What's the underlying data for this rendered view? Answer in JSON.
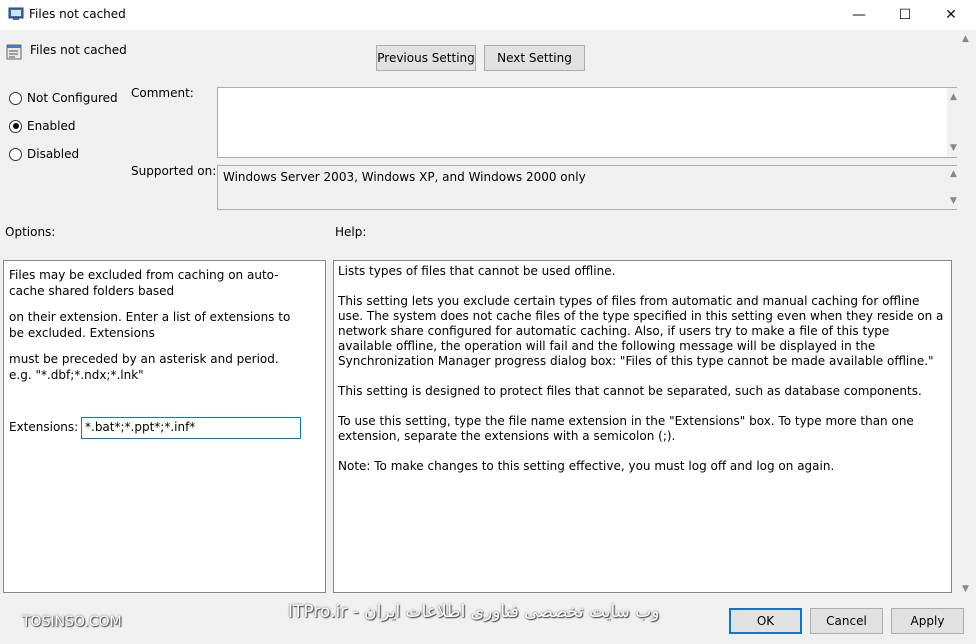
{
  "window": {
    "title": "Files not cached",
    "minimize": "—",
    "maximize": "☐",
    "close": "✕"
  },
  "header": {
    "policy_name": "Files not cached"
  },
  "nav": {
    "previous": "Previous Setting",
    "next": "Next Setting"
  },
  "state": {
    "options": [
      {
        "label": "Not Configured",
        "selected": false
      },
      {
        "label": "Enabled",
        "selected": true
      },
      {
        "label": "Disabled",
        "selected": false
      }
    ]
  },
  "comment": {
    "label": "Comment:",
    "value": ""
  },
  "supported": {
    "label": "Supported on:",
    "value": "Windows Server 2003, Windows XP, and Windows 2000 only"
  },
  "options_section": {
    "label": "Options:",
    "desc1": "Files may be excluded from caching on auto-cache shared folders based",
    "desc2": "on their extension. Enter a list of extensions to be excluded. Extensions",
    "desc3": "must be preceded by an asterisk and period. e.g. \"*.dbf;*.ndx;*.lnk\"",
    "ext_label": "Extensions:",
    "ext_value": "*.bat*;*.ppt*;*.inf*"
  },
  "help": {
    "label": "Help:",
    "p1": "Lists types of files that cannot be used offline.",
    "p2": "This setting lets you exclude certain types of files from automatic and manual caching for offline use. The system does not cache files of the type specified in this setting even when they reside on a network share configured for automatic caching. Also, if users try to make a file of this type available offline, the operation will fail and the following message will be displayed in the Synchronization Manager progress dialog box: \"Files of this type cannot be made available offline.\"",
    "p3": "This setting is designed to protect files that cannot be separated, such as database components.",
    "p4": "To use this setting, type the file name extension in the \"Extensions\" box. To type more than one extension, separate the extensions with a semicolon (;).",
    "p5": "Note: To make changes to this setting effective, you must log off and log on again."
  },
  "footer": {
    "ok": "OK",
    "cancel": "Cancel",
    "apply": "Apply"
  },
  "watermarks": {
    "left": "TOSINSO.COM",
    "center": "وب سایت تخصصی فناوری اطلاعات ایران - ITPro.ir"
  }
}
